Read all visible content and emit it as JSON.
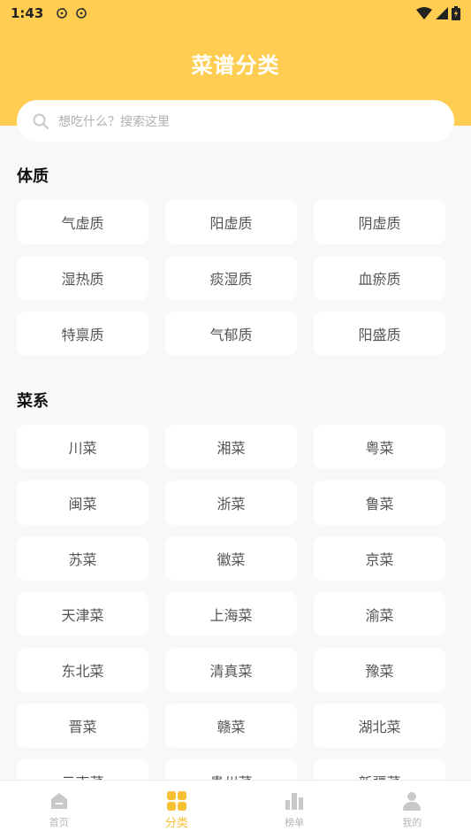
{
  "status_bar": {
    "time": "1:43"
  },
  "header": {
    "title": "菜谱分类"
  },
  "search": {
    "placeholder": "想吃什么？搜索这里"
  },
  "sections": [
    {
      "title": "体质",
      "items": [
        "气虚质",
        "阳虚质",
        "阴虚质",
        "湿热质",
        "痰湿质",
        "血瘀质",
        "特禀质",
        "气郁质",
        "阳盛质"
      ]
    },
    {
      "title": "菜系",
      "items": [
        "川菜",
        "湘菜",
        "粤菜",
        "闽菜",
        "浙菜",
        "鲁菜",
        "苏菜",
        "徽菜",
        "京菜",
        "天津菜",
        "上海菜",
        "渝菜",
        "东北菜",
        "清真菜",
        "豫菜",
        "晋菜",
        "赣菜",
        "湖北菜",
        "云南菜",
        "贵州菜",
        "新疆菜"
      ]
    }
  ],
  "tabbar": {
    "tabs": [
      {
        "label": "首页",
        "icon": "home-icon",
        "active": false
      },
      {
        "label": "分类",
        "icon": "category-grid-icon",
        "active": true
      },
      {
        "label": "榜单",
        "icon": "ranking-icon",
        "active": false
      },
      {
        "label": "我的",
        "icon": "profile-icon",
        "active": false
      }
    ]
  },
  "colors": {
    "brand": "#fecd52",
    "active_tab": "#f7c033",
    "background": "#f8f8f8",
    "chip": "#ffffff"
  }
}
